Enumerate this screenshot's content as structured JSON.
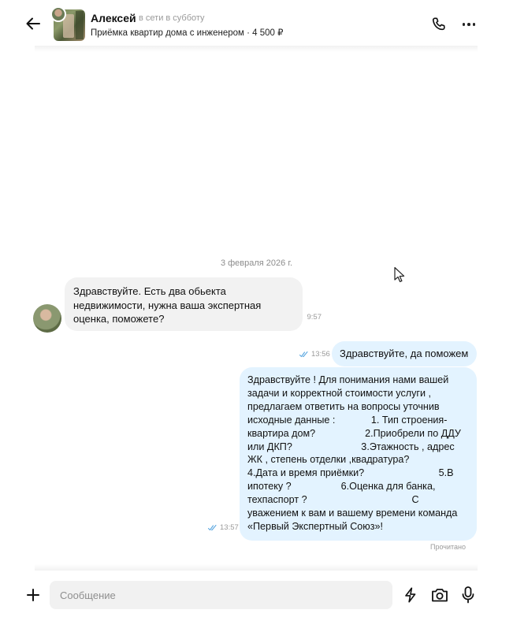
{
  "header": {
    "contact_name": "Алексей",
    "status": "в сети в субботу",
    "subtitle": "Приёмка квартир дома с инженером · 4 500 ₽",
    "icons": {
      "back": "arrow-left-icon",
      "phone": "phone-icon",
      "more": "more-dots-icon"
    }
  },
  "chat": {
    "date_separator": "3 февраля 2026 г.",
    "messages": [
      {
        "direction": "incoming",
        "text": "Здравствуйте. Есть два обьекта недвижимости, нужна ваша экспертная оценка, поможете?",
        "time": "9:57"
      },
      {
        "direction": "outgoing",
        "text": "Здравствуйте, да поможем",
        "time": "13:56",
        "status_icon": "double-check-icon"
      },
      {
        "direction": "outgoing",
        "text": "Здравствуйте ! Для понимания нами вашей\nзадачи и корректной стоимости услуги ,\nпредлагаем ответить на вопросы уточнив\nисходные данные :             1. Тип строения-\nквартира дом?                  2.Приобрели по ДДУ\nили ДКП?                         3.Этажность , адрес\nЖК , степень отделки ,квадратура?\n4.Дата и время приёмки?                           5.В\nипотеку ?                  6.Оценка для банка,\nтехпаспорт ?                                      С\nуважением к вам и вашему времени команда\n«Первый Экспертный Союз»!",
        "time": "13:57",
        "status_icon": "double-check-icon"
      }
    ],
    "read_status": "Прочитано"
  },
  "composer": {
    "placeholder": "Сообщение",
    "value": "",
    "icons": {
      "attach": "plus-icon",
      "quick": "lightning-icon",
      "camera": "camera-icon",
      "mic": "microphone-icon"
    }
  },
  "colors": {
    "outgoing_bubble": "#e3f3ff",
    "incoming_bubble": "#f2f2f2",
    "check_marks": "#5aa7e0"
  }
}
